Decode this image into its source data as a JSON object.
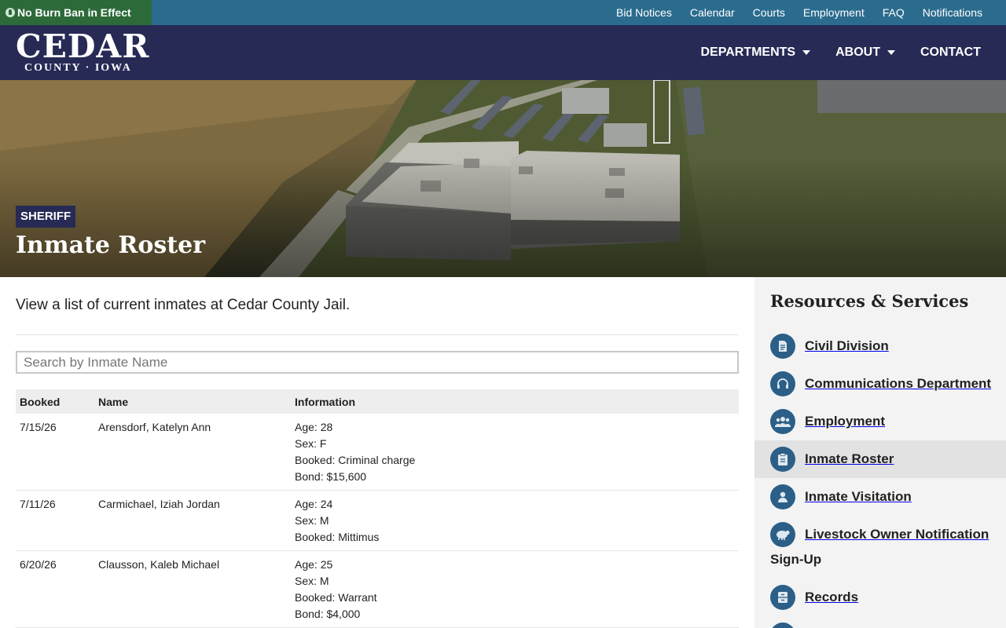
{
  "alert": {
    "text": "No Burn Ban in Effect"
  },
  "utility_nav": [
    "Bid Notices",
    "Calendar",
    "Courts",
    "Employment",
    "FAQ",
    "Notifications"
  ],
  "logo": {
    "main": "CEDAR",
    "sub": "COUNTY · IOWA"
  },
  "main_nav": {
    "departments": "DEPARTMENTS",
    "about": "ABOUT",
    "contact": "CONTACT"
  },
  "hero": {
    "badge": "SHERIFF",
    "title": "Inmate Roster"
  },
  "intro": "View a list of current inmates at Cedar County Jail.",
  "search": {
    "placeholder": "Search by Inmate Name",
    "value": ""
  },
  "table": {
    "headers": {
      "booked": "Booked",
      "name": "Name",
      "information": "Information"
    },
    "rows": [
      {
        "booked": "7/15/26",
        "name": "Arensdorf, Katelyn Ann",
        "info": [
          "Age: 28",
          "Sex: F",
          "Booked: Criminal charge",
          "Bond: $15,600"
        ]
      },
      {
        "booked": "7/11/26",
        "name": "Carmichael, Iziah Jordan",
        "info": [
          "Age: 24",
          "Sex: M",
          "Booked: Mittimus"
        ]
      },
      {
        "booked": "6/20/26",
        "name": "Clausson, Kaleb Michael",
        "info": [
          "Age: 25",
          "Sex: M",
          "Booked: Warrant",
          "Bond: $4,000"
        ]
      }
    ]
  },
  "sidebar": {
    "title": "Resources & Services",
    "items": [
      {
        "label": "Civil Division",
        "icon": "document-icon"
      },
      {
        "label": "Communications Department",
        "icon": "headset-icon"
      },
      {
        "label": "Employment",
        "icon": "people-icon"
      },
      {
        "label": "Inmate Roster",
        "icon": "clipboard-icon",
        "active": true
      },
      {
        "label": "Inmate Visitation",
        "icon": "person-icon"
      },
      {
        "label": "Livestock Owner Notification",
        "label_line2": "Sign-Up",
        "icon": "sheep-icon"
      },
      {
        "label": "Records",
        "icon": "records-icon"
      }
    ]
  },
  "colors": {
    "topbar": "#2b6c8e",
    "alert_bg": "#2c6a3a",
    "header": "#272a55",
    "icon_circle": "#2b5f88",
    "sidebar_bg": "#f3f3f3",
    "active_item": "#e2e2e2"
  }
}
